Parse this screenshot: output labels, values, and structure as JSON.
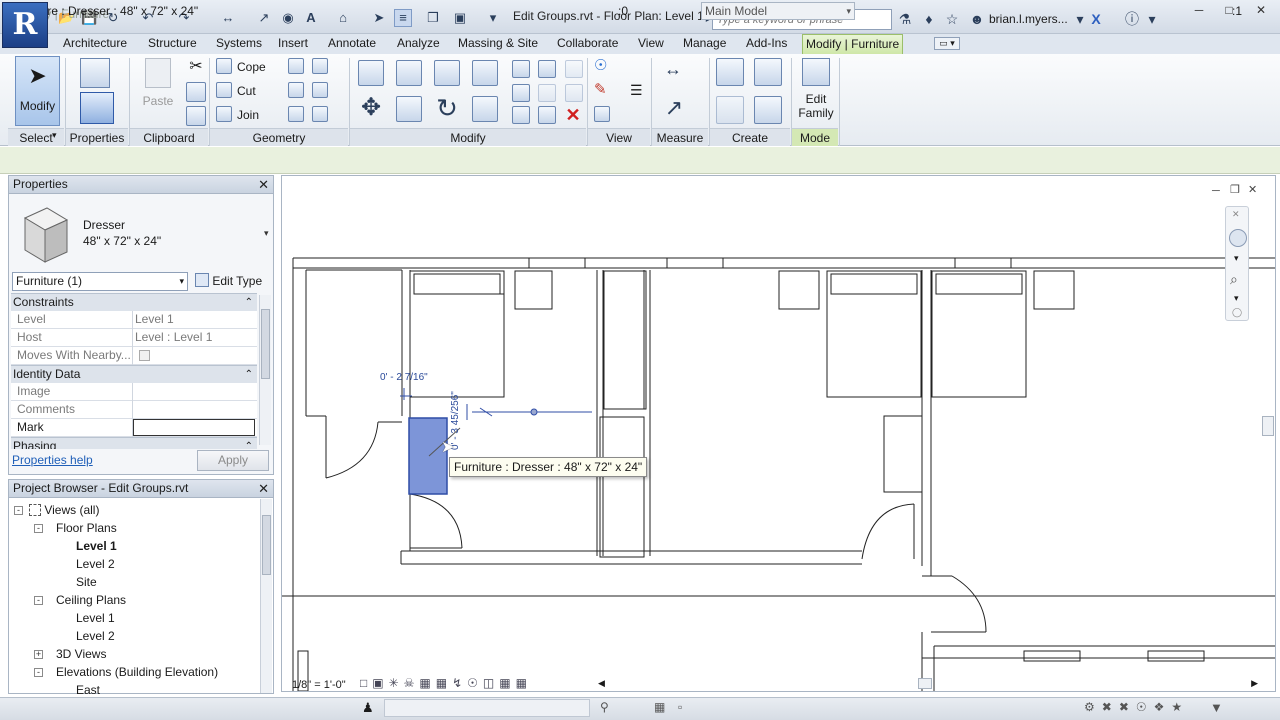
{
  "window": {
    "title": "Edit Groups.rvt - Floor Plan: Level 1",
    "search_placeholder": "Type a keyword or phrase",
    "user": "brian.l.myers..."
  },
  "app_logo": "R",
  "ribbon_tabs": [
    {
      "label": "Architecture"
    },
    {
      "label": "Structure"
    },
    {
      "label": "Systems"
    },
    {
      "label": "Insert"
    },
    {
      "label": "Annotate"
    },
    {
      "label": "Analyze"
    },
    {
      "label": "Massing & Site"
    },
    {
      "label": "Collaborate"
    },
    {
      "label": "View"
    },
    {
      "label": "Manage"
    },
    {
      "label": "Add-Ins"
    },
    {
      "label": "Modify | Furniture"
    }
  ],
  "ribbon": {
    "modify_label": "Modify",
    "paste_label": "Paste",
    "cope_label": "Cope",
    "cut_label": "Cut",
    "join_label": "Join",
    "edit_family_line1": "Edit",
    "edit_family_line2": "Family",
    "panels": {
      "select": "Select",
      "properties": "Properties",
      "clipboard": "Clipboard",
      "geometry": "Geometry",
      "modify": "Modify",
      "view": "View",
      "measure": "Measure",
      "create": "Create",
      "mode": "Mode"
    }
  },
  "context_bar": "Modify | Furniture",
  "properties_panel": {
    "title": "Properties",
    "type_name": "Dresser",
    "type_size": "48\" x 72\" x 24\"",
    "instance_filter": "Furniture (1)",
    "edit_type": "Edit Type",
    "sections": {
      "constraints": "Constraints",
      "identity": "Identity Data",
      "phasing": "Phasing"
    },
    "rows": {
      "level_k": "Level",
      "level_v": "Level 1",
      "host_k": "Host",
      "host_v": "Level : Level 1",
      "moves_k": "Moves With Nearby...",
      "image_k": "Image",
      "comments_k": "Comments",
      "mark_k": "Mark"
    },
    "help_link": "Properties help",
    "apply": "Apply"
  },
  "project_browser": {
    "title": "Project Browser - Edit Groups.rvt",
    "items": {
      "views_all": "Views (all)",
      "floor_plans": "Floor Plans",
      "fp_level1": "Level 1",
      "fp_level2": "Level 2",
      "fp_site": "Site",
      "ceiling_plans": "Ceiling Plans",
      "cp_level1": "Level 1",
      "cp_level2": "Level 2",
      "views_3d": "3D Views",
      "elevations": "Elevations (Building Elevation)",
      "el_east": "East"
    }
  },
  "drawing": {
    "tooltip": "Furniture : Dresser : 48\" x 72\" x 24\"",
    "dim_horizontal": "0' - 2 7/16\"",
    "dim_vertical": "0' - 3 45/256\"",
    "view_scale": "1/8\" = 1'-0\"",
    "selected_color": "#7d95d8"
  },
  "statusbar": {
    "text": "Furniture : Dresser : 48\" x 72\" x 24\"",
    "zero": ":0",
    "model": "Main Model",
    "filter_count": ":1"
  }
}
